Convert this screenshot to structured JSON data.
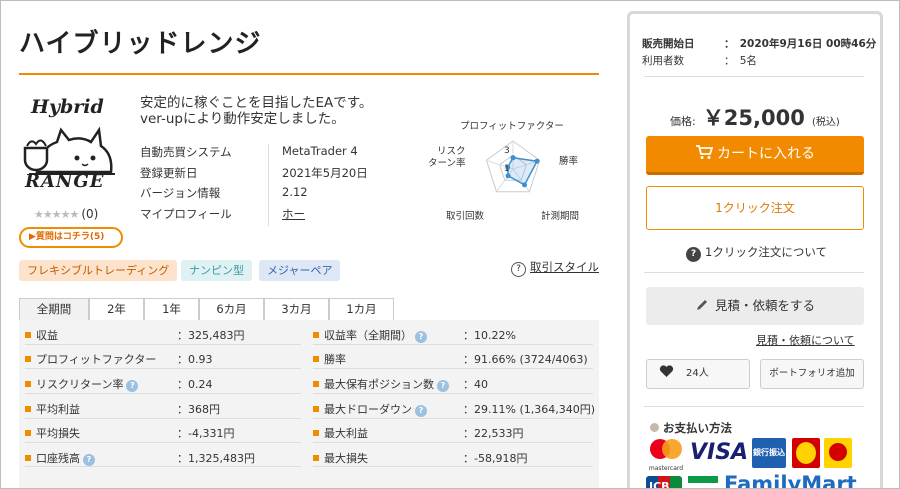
{
  "product": {
    "title": "ハイブリッドレンジ",
    "logo_line1": "Hybrid",
    "logo_line2": "RANGE",
    "stars": "★★★★★",
    "review_count": "(0)",
    "question_badge": "▶質問はコチラ(5)",
    "description_line1": "安定的に稼ぐことを目指したEAです。",
    "description_line2": "ver-upにより動作安定しました。"
  },
  "info": [
    {
      "label": "自動売買システム",
      "value": "MetaTrader 4"
    },
    {
      "label": "登録更新日",
      "value": "2021年5月20日"
    },
    {
      "label": "バージョン情報",
      "value": "2.12"
    },
    {
      "label": "マイプロフィール",
      "value": "ホー"
    }
  ],
  "radar": {
    "label_top": "プロフィットファクター",
    "label_risk": "リスク\nターン率",
    "label_winrate": "勝率",
    "label_trades": "取引回数",
    "label_period": "計測期間",
    "scale_3": "3",
    "scale_1": "1",
    "values": {
      "profit_factor": 2,
      "win_rate": 4.5,
      "period": 3.5,
      "trades": 1.5,
      "risk_return": 1
    }
  },
  "tags": [
    {
      "label": "フレキシブルトレーディング",
      "bg": "#fde3cc",
      "fg": "#c05a00"
    },
    {
      "label": "ナンピン型",
      "bg": "#dff1f3",
      "fg": "#3a9aa5"
    },
    {
      "label": "メジャーペア",
      "bg": "#dde7f6",
      "fg": "#3c64a8"
    }
  ],
  "trade_style_link": "取引スタイル",
  "tabs": [
    "全期間",
    "2年",
    "1年",
    "6カ月",
    "3カ月",
    "1カ月"
  ],
  "stats_left": [
    {
      "label": "収益",
      "value": "：325,483円",
      "help": false
    },
    {
      "label": "プロフィットファクター",
      "value": "：0.93",
      "help": false
    },
    {
      "label": "リスクリターン率",
      "value": "：0.24",
      "help": true
    },
    {
      "label": "平均利益",
      "value": "：368円",
      "help": false
    },
    {
      "label": "平均損失",
      "value": "：-4,331円",
      "help": false
    },
    {
      "label": "口座残高",
      "value": "：1,325,483円",
      "help": true
    }
  ],
  "stats_right": [
    {
      "label": "収益率（全期間）",
      "value": "：10.22%",
      "help": true
    },
    {
      "label": "勝率",
      "value": "：91.66% (3724/4063)",
      "help": false
    },
    {
      "label": "最大保有ポジション数",
      "value": "：40",
      "help": true
    },
    {
      "label": "最大ドローダウン",
      "value": "：29.11% (1,364,340円)",
      "help": true
    },
    {
      "label": "最大利益",
      "value": "：22,533円",
      "help": false
    },
    {
      "label": "最大損失",
      "value": "：-58,918円",
      "help": false
    }
  ],
  "sidebar": {
    "release_label": "販売開始日",
    "release_value": "：　2020年9月16日 00時46分",
    "users_label": "利用者数",
    "users_value": "：　5名",
    "price_label": "価格:",
    "price_value": "￥25,000",
    "price_tax": "(税込)",
    "cart_button": "カートに入れる",
    "one_click_button": "1クリック注文",
    "one_click_about": "1クリック注文について",
    "estimate_button": "見積・依頼をする",
    "estimate_link": "見積・依頼について",
    "like_count": "24人",
    "portfolio_button": "ポートフォリオ追加",
    "payment_heading": "お支払い方法",
    "pay_visa": "VISA",
    "pay_mastercard": "mastercard",
    "pay_bank": "銀行振込",
    "pay_jcb": "JCB",
    "pay_familymart": "FamilyMart"
  },
  "colors": {
    "accent": "#f08c00",
    "cart": "#f28a00",
    "radar": "#3c8fd0"
  }
}
